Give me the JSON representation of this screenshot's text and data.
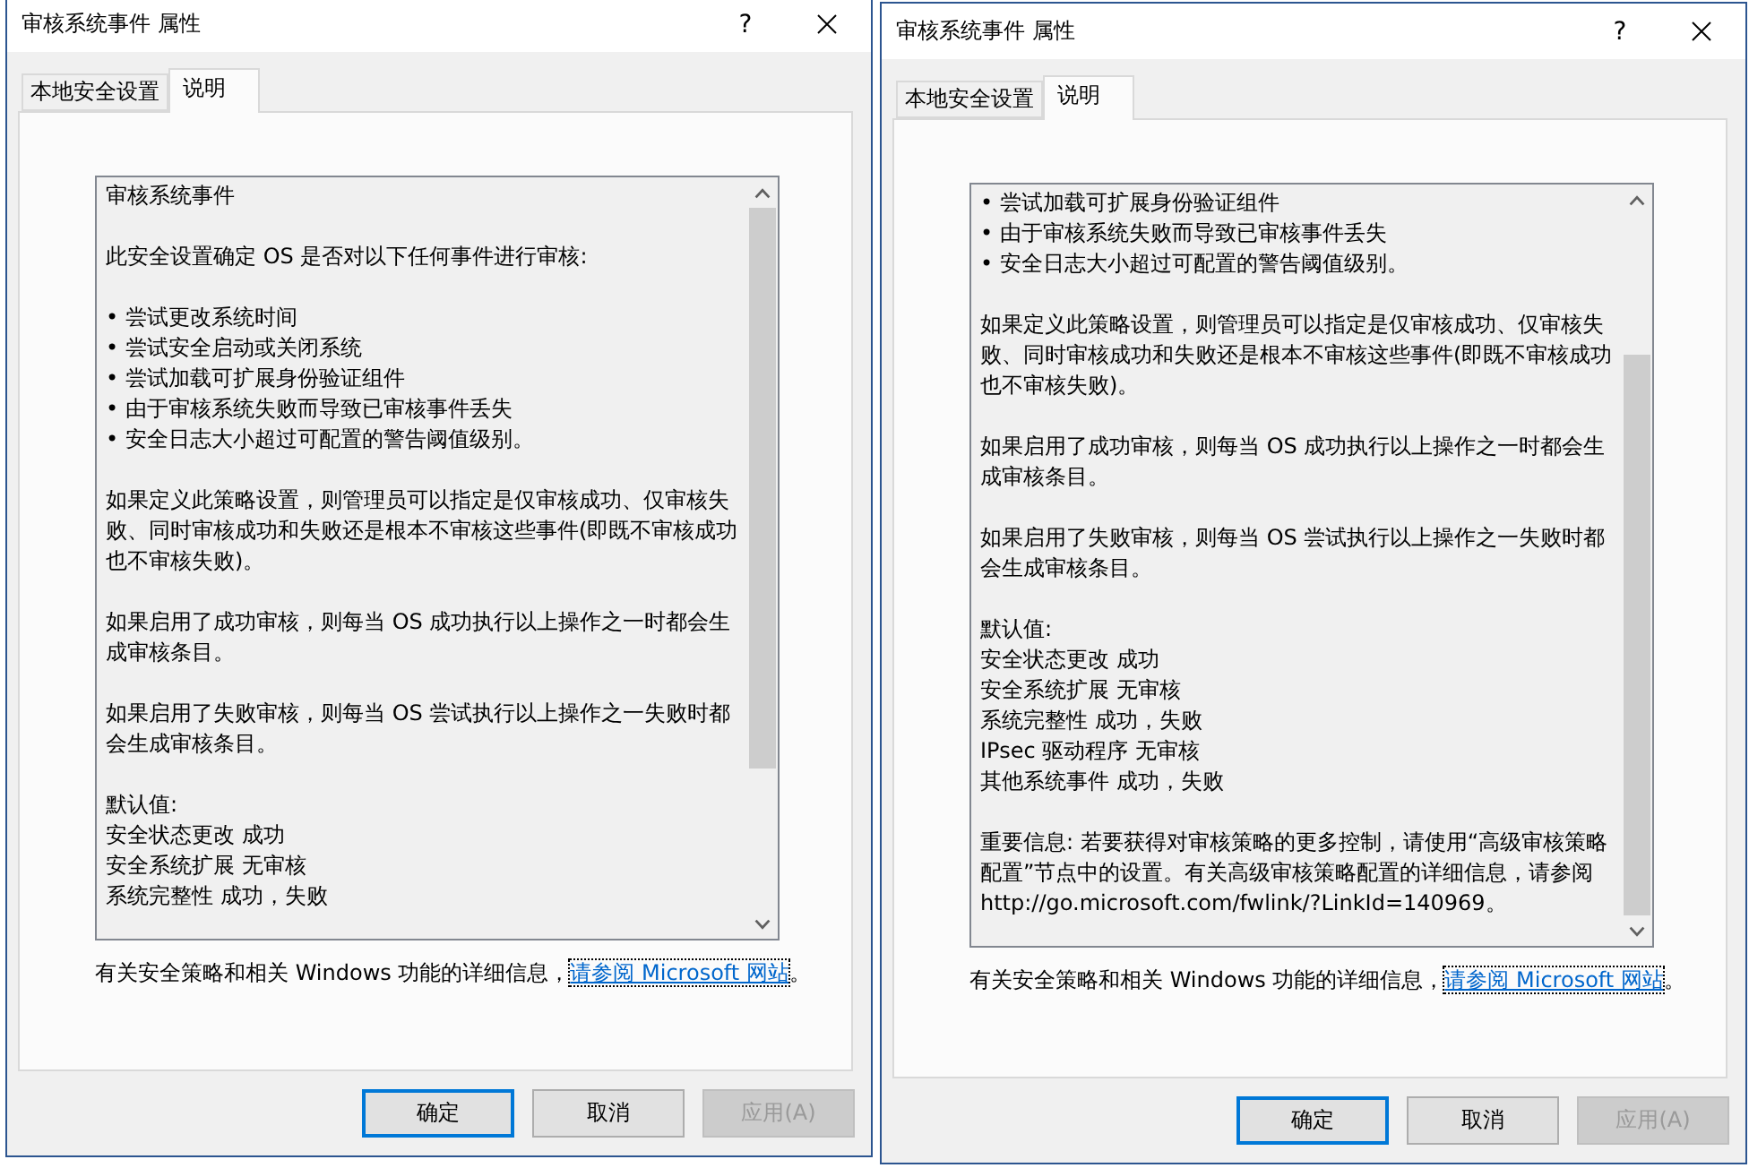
{
  "dialogs": [
    {
      "title": "审核系统事件 属性",
      "help": "?",
      "tabs": [
        {
          "label": "本地安全设置",
          "selected": false
        },
        {
          "label": "说明",
          "selected": true
        }
      ],
      "description": {
        "scrolled_down": false,
        "blocks": [
          {
            "kind": "paragraph",
            "text": "审核系统事件"
          },
          {
            "kind": "paragraph",
            "text": "此安全设置确定 OS 是否对以下任何事件进行审核:"
          },
          {
            "kind": "list",
            "items": [
              "• 尝试更改系统时间",
              "• 尝试安全启动或关闭系统",
              "• 尝试加载可扩展身份验证组件",
              "• 由于审核系统失败而导致已审核事件丢失",
              "• 安全日志大小超过可配置的警告阈值级别。"
            ]
          },
          {
            "kind": "paragraph",
            "text": "如果定义此策略设置，则管理员可以指定是仅审核成功、仅审核失败、同时审核成功和失败还是根本不审核这些事件(即既不审核成功也不审核失败)。"
          },
          {
            "kind": "paragraph",
            "text": "如果启用了成功审核，则每当 OS 成功执行以上操作之一时都会生成审核条目。"
          },
          {
            "kind": "paragraph",
            "text": "如果启用了失败审核，则每当 OS 尝试执行以上操作之一失败时都会生成审核条目。"
          },
          {
            "kind": "lines",
            "items": [
              "默认值:",
              "安全状态更改 成功",
              "安全系统扩展 无审核",
              "系统完整性 成功，失败"
            ]
          }
        ]
      },
      "info": {
        "text": "有关安全策略和相关 Windows 功能的详细信息，",
        "link": {
          "text": "请参阅 Microsoft 网站",
          "focused": true
        },
        "end": "。"
      },
      "buttons": [
        {
          "label": "确定",
          "default": true,
          "disabled": false
        },
        {
          "label": "取消",
          "default": false,
          "disabled": false
        },
        {
          "label": "应用(A)",
          "default": false,
          "disabled": true
        }
      ]
    },
    {
      "title": "审核系统事件 属性",
      "help": "?",
      "tabs": [
        {
          "label": "本地安全设置",
          "selected": false
        },
        {
          "label": "说明",
          "selected": true
        }
      ],
      "description": {
        "scrolled_down": true,
        "blocks": [
          {
            "kind": "list",
            "items": [
              "• 尝试加载可扩展身份验证组件",
              "• 由于审核系统失败而导致已审核事件丢失",
              "• 安全日志大小超过可配置的警告阈值级别。"
            ]
          },
          {
            "kind": "paragraph",
            "text": "如果定义此策略设置，则管理员可以指定是仅审核成功、仅审核失败、同时审核成功和失败还是根本不审核这些事件(即既不审核成功也不审核失败)。"
          },
          {
            "kind": "paragraph",
            "text": "如果启用了成功审核，则每当 OS 成功执行以上操作之一时都会生成审核条目。"
          },
          {
            "kind": "paragraph",
            "text": "如果启用了失败审核，则每当 OS 尝试执行以上操作之一失败时都会生成审核条目。"
          },
          {
            "kind": "lines",
            "items": [
              "默认值:",
              "安全状态更改 成功",
              "安全系统扩展 无审核",
              "系统完整性 成功，失败",
              "IPsec 驱动程序 无审核",
              "其他系统事件 成功，失败"
            ]
          },
          {
            "kind": "paragraph",
            "text": "重要信息: 若要获得对审核策略的更多控制，请使用“高级审核策略配置”节点中的设置。有关高级审核策略配置的详细信息，请参阅 http://go.microsoft.com/fwlink/?LinkId=140969。"
          }
        ]
      },
      "info": {
        "text": "有关安全策略和相关 Windows 功能的详细信息，",
        "link": {
          "text": "请参阅 Microsoft 网站",
          "focused": true
        },
        "end": "。"
      },
      "buttons": [
        {
          "label": "确定",
          "default": true,
          "disabled": false
        },
        {
          "label": "取消",
          "default": false,
          "disabled": false
        },
        {
          "label": "应用(A)",
          "default": false,
          "disabled": true
        }
      ]
    }
  ]
}
